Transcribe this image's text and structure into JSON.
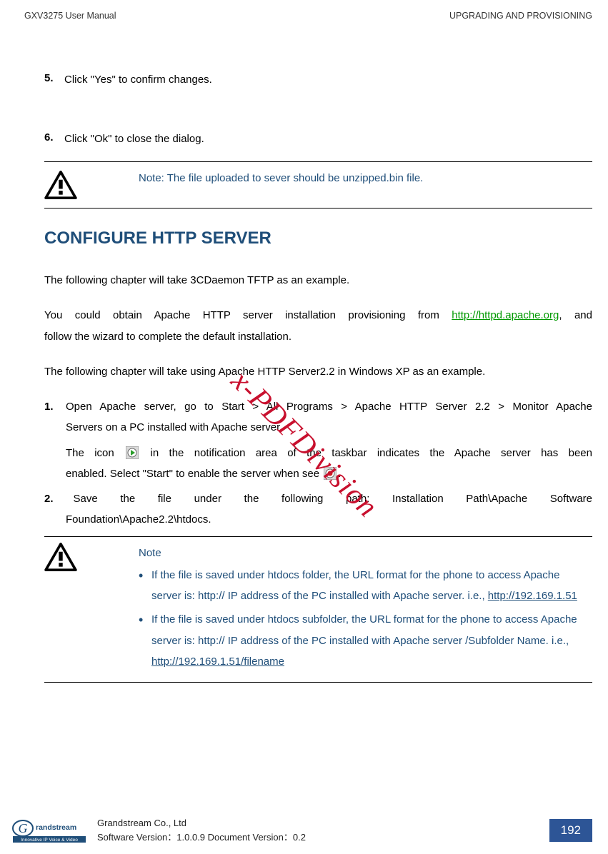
{
  "header": {
    "left": "GXV3275 User Manual",
    "right": "UPGRADING AND PROVISIONING"
  },
  "steps": {
    "s5_num": "5.",
    "s5": "Click \"Yes\" to confirm changes.",
    "s6_num": "6.",
    "s6": "Click \"Ok\" to close the dialog."
  },
  "note1": "Note: The file uploaded to sever should be unzipped.bin file.",
  "section_title": "CONFIGURE HTTP SERVER",
  "p1": "The following chapter will take 3CDaemon TFTP as an example.",
  "p2_a": "You could obtain Apache HTTP server installation provisioning from ",
  "p2_link": "http://httpd.apache.org",
  "p2_b": ", and",
  "p2_c": "follow the wizard to complete the default installation.",
  "p3": "The following chapter will take using Apache HTTP Server2.2 in Windows XP as an example.",
  "list": {
    "n1_num": "1.",
    "n1_l1": "Open Apache server, go to Start > All Programs > Apache HTTP Server 2.2 > Monitor Apache",
    "n1_l2": "Servers on a PC installed with Apache server.",
    "n1_l3a": "The icon",
    "n1_l3b": "in the notification area of the taskbar indicates the Apache server has been",
    "n1_l4a": "enabled. Select \"Start\" to enable the server when see",
    "n1_l4b": ".",
    "n2_num": "2.",
    "n2_l1": " Save   the   file   under   the   following   path:   Installation   Path\\Apache   Software",
    "n2_l2": "Foundation\\Apache2.2\\htdocs."
  },
  "note2": {
    "heading": "Note",
    "b1_l1": "If the file is saved under htdocs folder, the URL format for the phone to access",
    "b1_l2": "Apache server is: http:// IP address of the PC installed with Apache server. i.e.,",
    "b1_link": "http://192.169.1.51",
    "b2_l1": "If the file is saved under htdocs subfolder, the URL format for the phone to",
    "b2_l2": "access Apache server is: http:// IP address of the PC installed with Apache server",
    "b2_l3a": "/Subfolder Name. i.e., ",
    "b2_link": "http://192.169.1.51/filename"
  },
  "watermark": "x-PDFDivision",
  "footer": {
    "company": "Grandstream Co., Ltd",
    "version": "Software Version：1.0.0.9 Document Version：0.2",
    "page": "192",
    "logo_text": "Grandstream",
    "logo_tag": "Innovative IP Voice & Video"
  }
}
